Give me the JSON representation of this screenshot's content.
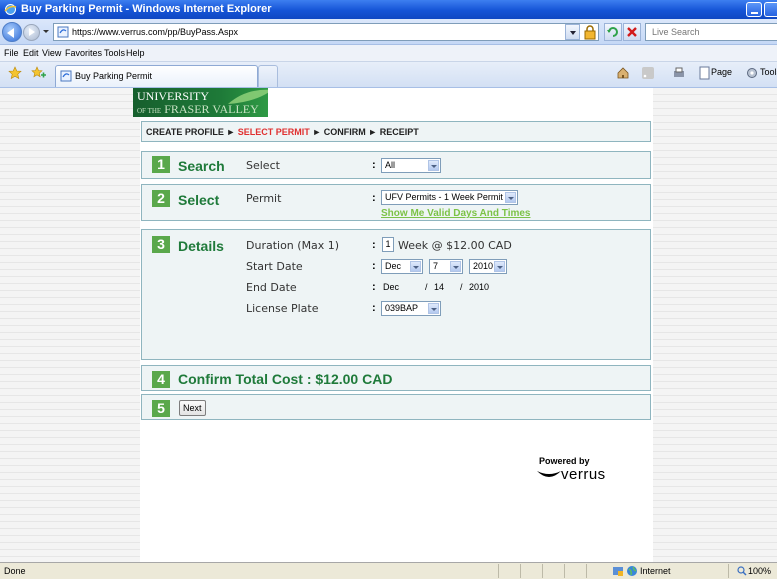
{
  "window": {
    "title": "Buy Parking Permit - Windows Internet Explorer"
  },
  "address_bar": {
    "url": "https://www.verrus.com/pp/BuyPass.Aspx",
    "search_placeholder": "Live Search"
  },
  "menu": [
    "File",
    "Edit",
    "View",
    "Favorites",
    "Tools",
    "Help"
  ],
  "tab": {
    "label": "Buy Parking Permit"
  },
  "command_bar": {
    "page_label": "Page",
    "tools_label": "Tools"
  },
  "logo": {
    "line1": "UNIVERSITY",
    "line2_small": "OF THE",
    "line2": "FRASER VALLEY"
  },
  "breadcrumb": {
    "create_profile": "CREATE PROFILE",
    "select_permit": "SELECT PERMIT",
    "confirm": "CONFIRM",
    "receipt": "RECEIPT",
    "separator": "►"
  },
  "steps": {
    "search": {
      "number": "1",
      "title": "Search",
      "field_label": "Select",
      "select_value": "All"
    },
    "select": {
      "number": "2",
      "title": "Select",
      "field_label": "Permit",
      "select_value": "UFV Permits - 1 Week Permit",
      "valid_days_link": "Show Me Valid Days And Times"
    },
    "details": {
      "number": "3",
      "title": "Details",
      "duration_label": "Duration (Max 1)",
      "duration_value": "1",
      "duration_text": "Week @ $12.00 CAD",
      "start_date_label": "Start Date",
      "start_month": "Dec",
      "start_day": "7",
      "start_year": "2010",
      "end_date_label": "End Date",
      "end_month": "Dec",
      "end_day": "14",
      "end_year": "2010",
      "license_plate_label": "License Plate",
      "license_plate_value": "039BAP"
    },
    "confirm": {
      "number": "4",
      "title": "Confirm Total Cost : $12.00 CAD"
    },
    "next": {
      "number": "5",
      "button_label": "Next"
    }
  },
  "colon": ":",
  "powered_by": {
    "text": "Powered by",
    "brand": "verrus"
  },
  "status_bar": {
    "status": "Done",
    "zone": "Internet",
    "zoom": "100%"
  },
  "colors": {
    "titlebar": "#1554d6",
    "step_green": "#5aa84b",
    "title_green": "#1f7a3a",
    "link_green": "#7cc246",
    "breadcrumb_active": "#e03030",
    "panel_bg": "#eef4f5",
    "panel_border": "#8fb5bf"
  }
}
